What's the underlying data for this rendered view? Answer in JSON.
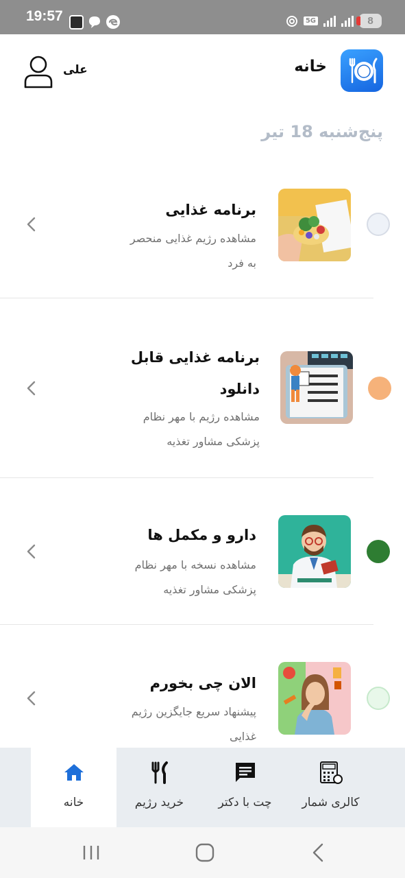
{
  "status_bar": {
    "time": "19:57",
    "network": "5G",
    "battery": "8",
    "icons": [
      "app-notification-icon",
      "chat-bubble-icon",
      "edge-icon",
      "hotspot-icon",
      "signal-icon",
      "battery-icon"
    ]
  },
  "header": {
    "title": "خانه",
    "user_name": "علی",
    "logo_icon": "plate-fork-knife-icon",
    "avatar_icon": "user-outline-icon"
  },
  "date": "پنج‌شنبه 18 تیر",
  "cards": [
    {
      "title": "برنامه غذایی",
      "description": [
        "مشاهده رژیم غذایی منحصر",
        "به فرد"
      ],
      "dot_color": "#eef2f8",
      "dot_border": "#d7dce6",
      "thumb": "diet-plate-illustration"
    },
    {
      "title": [
        "برنامه غذایی قابل",
        "دانلود"
      ],
      "description": [
        "مشاهده رژیم با مهر نظام",
        "پزشکی مشاور تغذیه"
      ],
      "dot_color": "#f6b27a",
      "dot_border": "#f6b27a",
      "thumb": "downloadable-plan-illustration"
    },
    {
      "title": "دارو و مکمل ها",
      "description": [
        "مشاهده نسخه با مهر نظام",
        "پزشکی مشاور تغذیه"
      ],
      "dot_color": "#2e7d32",
      "dot_border": "#2e7d32",
      "thumb": "doctor-illustration"
    },
    {
      "title": "الان چی بخورم",
      "description": [
        "پیشنهاد سریع جایگزین رژیم",
        "غذایی"
      ],
      "dot_color": "#e8f8ea",
      "dot_border": "#c6e9cb",
      "thumb": "hungry-person-illustration"
    }
  ],
  "bottom_nav": [
    {
      "label": "خانه",
      "icon": "home-icon",
      "active": true
    },
    {
      "label": "خرید رژیم",
      "icon": "fork-knife-icon",
      "active": false
    },
    {
      "label": "چت با دکتر",
      "icon": "chat-icon",
      "active": false
    },
    {
      "label": "کالری شمار",
      "icon": "calorie-calculator-icon",
      "active": false
    }
  ],
  "colors": {
    "accent": "#1e6fd9",
    "status_bar": "#8e8e8e",
    "nav_background": "#e9edf1",
    "date_text": "#b3bcc8"
  }
}
